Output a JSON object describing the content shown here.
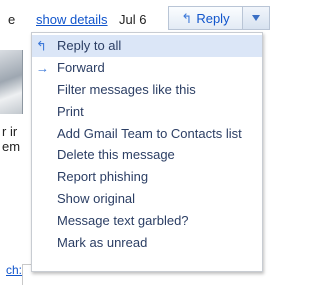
{
  "header": {
    "details_link": "show details",
    "date": "Jul 6",
    "reply_label": "Reply",
    "reply_icon": "reply-arrow-icon",
    "caret_icon": "chevron-down-icon"
  },
  "background": {
    "frag_e": "e",
    "frag_ir": "r ir",
    "frag_em": "em",
    "frag_link": "ch:"
  },
  "menu": {
    "items": [
      {
        "label": "Reply to all",
        "icon": "reply-all-icon"
      },
      {
        "label": "Forward",
        "icon": "forward-icon"
      },
      {
        "label": "Filter messages like this"
      },
      {
        "label": "Print"
      },
      {
        "label": "Add Gmail Team to Contacts list"
      },
      {
        "label": "Delete this message"
      },
      {
        "label": "Report phishing"
      },
      {
        "label": "Show original"
      },
      {
        "label": "Message text garbled?"
      },
      {
        "label": "Mark as unread"
      }
    ]
  },
  "colors": {
    "link": "#1155cc",
    "menu_text": "#2b3e64",
    "highlight": "#dbe6f7",
    "accent": "#3d79d9"
  }
}
